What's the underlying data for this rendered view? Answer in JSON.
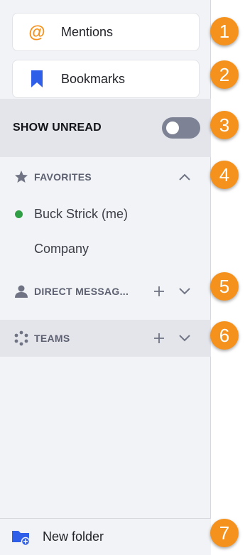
{
  "nav": {
    "mentions_label": "Mentions",
    "bookmarks_label": "Bookmarks"
  },
  "unread": {
    "label": "SHOW UNREAD",
    "enabled": false
  },
  "favorites": {
    "title": "FAVORITES",
    "items": [
      {
        "label": "Buck Strick (me)",
        "status": "online"
      },
      {
        "label": "Company"
      }
    ]
  },
  "direct_messages": {
    "title": "DIRECT MESSAG..."
  },
  "teams": {
    "title": "TEAMS"
  },
  "footer": {
    "new_folder_label": "New folder"
  },
  "badges": [
    "1",
    "2",
    "3",
    "4",
    "5",
    "6",
    "7"
  ],
  "colors": {
    "accent_orange": "#f5921e",
    "bookmark_blue": "#2f5ee8",
    "online_green": "#2f9e44"
  }
}
